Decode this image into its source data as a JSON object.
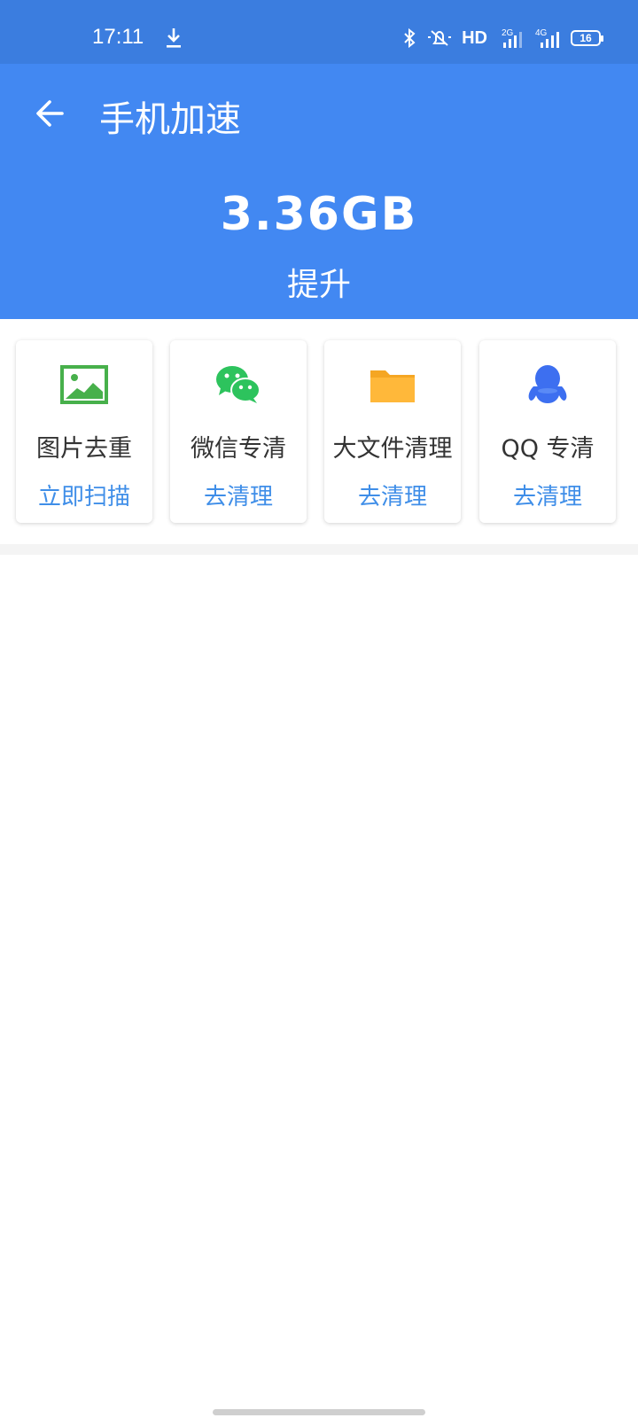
{
  "status_bar": {
    "time": "17:11",
    "hd": "HD",
    "network_2g": "2G",
    "network_4g": "4G",
    "battery": "16"
  },
  "header": {
    "title": "手机加速",
    "boost_amount": "3.36GB",
    "boost_label": "提升"
  },
  "tools": [
    {
      "name": "图片去重",
      "action": "立即扫描",
      "icon": "image-icon"
    },
    {
      "name": "微信专清",
      "action": "去清理",
      "icon": "wechat-icon"
    },
    {
      "name": "大文件清理",
      "action": "去清理",
      "icon": "folder-icon"
    },
    {
      "name": "QQ 专清",
      "action": "去清理",
      "icon": "qq-icon"
    }
  ],
  "colors": {
    "status_bar": "#3b7ddf",
    "header": "#4288f2",
    "action_text": "#3f8ee8"
  }
}
